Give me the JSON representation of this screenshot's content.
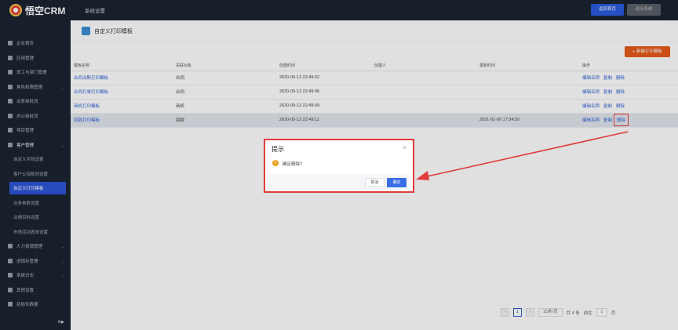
{
  "app": {
    "logo_text": "悟空CRM",
    "section_title": "系统设置"
  },
  "top_actions": {
    "home": "返回首页",
    "logout": "退出系统"
  },
  "sidebar": {
    "items": [
      {
        "label": "企业首页",
        "icon": "home-icon",
        "chevron": false
      },
      {
        "label": "应用管理",
        "icon": "grid-icon",
        "chevron": false
      },
      {
        "label": "员工与部门管理",
        "icon": "team-icon",
        "chevron": false
      },
      {
        "label": "角色权限管理",
        "icon": "user-icon",
        "chevron": true
      },
      {
        "label": "业务审批流",
        "icon": "user-icon",
        "chevron": false
      },
      {
        "label": "办公审批流",
        "icon": "user-icon",
        "chevron": false
      },
      {
        "label": "项目管理",
        "icon": "list-icon",
        "chevron": false
      },
      {
        "label": "客户管理",
        "icon": "file-icon",
        "chevron": true
      }
    ],
    "sub_items": [
      "自定义字段设置",
      "客户公海规则设置",
      "自定义打印模板",
      "业务参数设置",
      "业绩目标设置",
      "市场活动表单设置"
    ],
    "active_sub": "自定义打印模板",
    "lower_items": [
      {
        "label": "人力资源管理",
        "icon": "user-icon",
        "chevron": true
      },
      {
        "label": "进销存管理",
        "icon": "chart-icon",
        "chevron": true
      },
      {
        "label": "系统日志",
        "icon": "log-icon",
        "chevron": true
      },
      {
        "label": "其他设置",
        "icon": "gear-icon",
        "chevron": false
      },
      {
        "label": "初始化数据",
        "icon": "data-icon",
        "chevron": false
      }
    ]
  },
  "page": {
    "title": "自定义打印模板",
    "new_button": "+ 新建打印模板"
  },
  "table": {
    "columns": [
      "模板名称",
      "关联对象",
      "创建时间",
      "创建人",
      "更新时间",
      "操作"
    ],
    "rows": [
      {
        "name": "合同派斯打印模板",
        "object": "合同",
        "created": "2020-05-13 22:49:02",
        "creator": "",
        "updated": ""
      },
      {
        "name": "合同打单打印模板",
        "object": "合同",
        "created": "2020-05-13 22:49:06",
        "creator": "",
        "updated": ""
      },
      {
        "name": "商机打印模板",
        "object": "商机",
        "created": "2020-05-13 22:49:09",
        "creator": "",
        "updated": ""
      },
      {
        "name": "回款打印模板",
        "object": "回款",
        "created": "2020-05-13 22:49:11",
        "creator": "",
        "updated": "2021-01-06 17:34:50"
      }
    ],
    "actions": {
      "edit": "编辑名称",
      "copy": "复制",
      "delete": "删除"
    }
  },
  "pagination": {
    "page": "1",
    "page_size": "15条/页",
    "total": "共 4 条",
    "goto_label": "前往",
    "goto_value": "1",
    "goto_unit": "页"
  },
  "dialog": {
    "title": "提示",
    "message": "确定删除?",
    "cancel": "取消",
    "confirm": "确定"
  },
  "colors": {
    "sidebar_bg": "#1b2430",
    "accent": "#2d55d8",
    "new_button": "#e8591a",
    "annotation": "#e23b3b"
  }
}
